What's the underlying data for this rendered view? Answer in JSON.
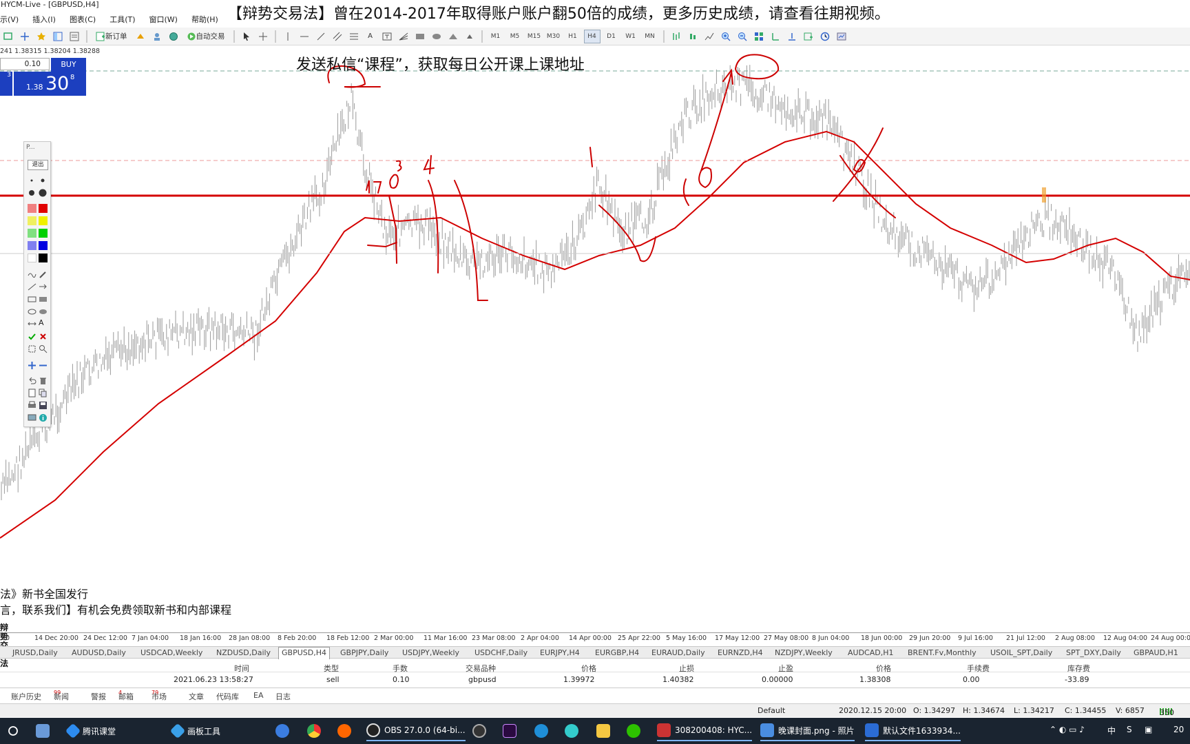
{
  "window": {
    "title": "HYCM-Live - [GBPUSD,H4]"
  },
  "banner": {
    "text": "【辩势交易法】曾在2014-2017年取得账户账户翻50倍的成绩，更多历史成绩，请查看往期视频。"
  },
  "subtitle": {
    "text": "发送私信“课程”，获取每日公开课上课地址"
  },
  "menu": {
    "items": [
      "示(V)",
      "插入(I)",
      "图表(C)",
      "工具(T)",
      "窗口(W)",
      "帮助(H)"
    ]
  },
  "toolbar": {
    "new_order": "新订单",
    "auto_trading": "自动交易",
    "timeframes": [
      "M1",
      "M5",
      "M15",
      "M30",
      "H1",
      "H4",
      "D1",
      "W1",
      "MN"
    ],
    "active_timeframe": "H4"
  },
  "chart_header": {
    "prices": "241 1.38315 1.38204 1.38288"
  },
  "one_click": {
    "lot": "0.10",
    "buy_label": "BUY",
    "price_small": "1.38",
    "price_big": "30",
    "price_sup": "8",
    "left_digit": "3"
  },
  "palette": {
    "title": "P...",
    "exit_label": "退出"
  },
  "bottom_text": {
    "line1": "法》新书全国发行",
    "line2": "言，联系我们】有机会免费领取新书和内部课程"
  },
  "side_logo": {
    "text": "辩势交易法"
  },
  "time_axis": [
    "00",
    "14 Dec 20:00",
    "24 Dec 12:00",
    "7 Jan 04:00",
    "18 Jan 16:00",
    "28 Jan 08:00",
    "8 Feb 20:00",
    "18 Feb 12:00",
    "2 Mar 00:00",
    "11 Mar 16:00",
    "23 Mar 08:00",
    "2 Apr 04:00",
    "14 Apr 00:00",
    "25 Apr 22:00",
    "5 May 16:00",
    "17 May 12:00",
    "27 May 08:00",
    "8 Jun 04:00",
    "18 Jun 00:00",
    "29 Jun 20:00",
    "9 Jul 16:00",
    "21 Jul 12:00",
    "2 Aug 08:00",
    "12 Aug 04:00",
    "24 Aug 00:00"
  ],
  "symbol_tabs": {
    "items": [
      "JRUSD,Daily",
      "AUDUSD,Daily",
      "USDCAD,Weekly",
      "NZDUSD,Daily",
      "GBPUSD,H4",
      "GBPJPY,Daily",
      "USDJPY,Weekly",
      "USDCHF,Daily",
      "EURJPY,H4",
      "EURGBP,H4",
      "EURAUD,Daily",
      "EURNZD,H4",
      "NZDJPY,Weekly",
      "AUDCAD,H1",
      "BRENT.Fv,Monthly",
      "USOIL_SPT,Daily",
      "SPT_DXY,Daily",
      "GBPAUD,H1"
    ],
    "active": "GBPUSD,H4"
  },
  "terminal": {
    "headers": [
      "时间",
      "类型",
      "手数",
      "交易品种",
      "价格",
      "止损",
      "止盈",
      "价格",
      "手续费",
      "库存费"
    ],
    "row": [
      "2021.06.23 13:58:27",
      "sell",
      "0.10",
      "gbpusd",
      "1.39972",
      "1.40382",
      "0.00000",
      "1.38308",
      "0.00",
      "-33.89"
    ],
    "tabs": [
      {
        "label": "账户历史",
        "badge": ""
      },
      {
        "label": "新闻",
        "badge": "99"
      },
      {
        "label": "警报",
        "badge": ""
      },
      {
        "label": "邮箱",
        "badge": "4"
      },
      {
        "label": "市场",
        "badge": "79"
      },
      {
        "label": "文章",
        "badge": ""
      },
      {
        "label": "代码库",
        "badge": ""
      },
      {
        "label": "EA",
        "badge": ""
      },
      {
        "label": "日志",
        "badge": ""
      }
    ]
  },
  "status": {
    "profile": "Default",
    "time": "2020.12.15 20:00",
    "open": "O: 1.34297",
    "high": "H: 1.34674",
    "low": "L: 1.34217",
    "close": "C: 1.34455",
    "volume": "V: 6857",
    "conn": "350"
  },
  "taskbar": {
    "items": [
      "腾讯课堂",
      "画板工具",
      "OBS 27.0.0 (64-bi...",
      "308200408: HYC...",
      "晚课封面.png - 照片",
      "默认文件1633934..."
    ],
    "ime": "中",
    "clock": "20"
  },
  "colors": {
    "price_line": "#d40000",
    "ma_line": "#d40000",
    "annotation": "#cc0000",
    "candle": "#9a9a9a",
    "buy": "#1c3fbf"
  }
}
